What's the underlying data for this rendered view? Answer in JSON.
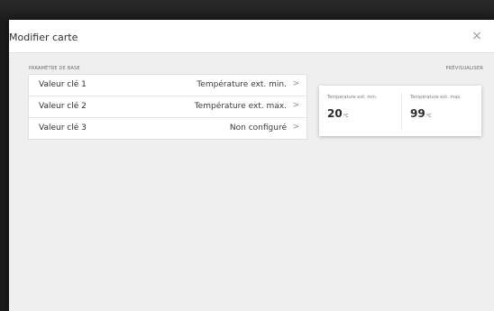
{
  "modal": {
    "title": "Modifier carte",
    "close_glyph": "×"
  },
  "sections": {
    "base_label": "PARAMÈTRE DE BASE",
    "preview_label": "PRÉVISUALISER"
  },
  "params": [
    {
      "key": "Valeur clé 1",
      "value": "Température ext. min.",
      "chevron": ">"
    },
    {
      "key": "Valeur clé 2",
      "value": "Température ext. max.",
      "chevron": ">"
    },
    {
      "key": "Valeur clé 3",
      "value": "Non configuré",
      "chevron": ">"
    }
  ],
  "preview": {
    "items": [
      {
        "label": "Température ext. min.",
        "value": "20",
        "unit": "°C"
      },
      {
        "label": "Température ext. max.",
        "value": "99",
        "unit": "°C"
      }
    ]
  },
  "icons": {
    "close": "close-icon",
    "chevron": "chevron-right-icon"
  }
}
